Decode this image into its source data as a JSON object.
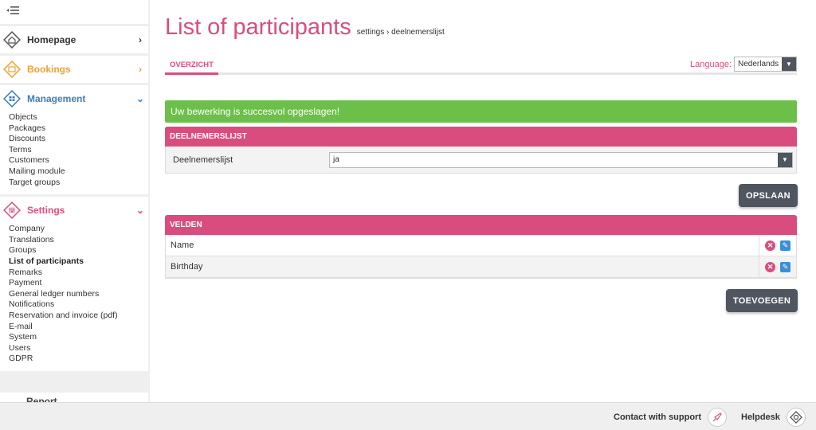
{
  "sidebar": {
    "toggle_icon": "collapse-menu-icon",
    "sections": {
      "homepage": {
        "label": "Homepage",
        "color": "#333333",
        "icon": "home-icon"
      },
      "bookings": {
        "label": "Bookings",
        "color": "#f0a22e",
        "icon": "bookings-icon"
      },
      "management": {
        "label": "Management",
        "color": "#3a7ec2",
        "icon": "management-icon",
        "items": [
          "Objects",
          "Packages",
          "Discounts",
          "Terms",
          "Customers",
          "Mailing module",
          "Target groups"
        ]
      },
      "settings": {
        "label": "Settings",
        "color": "#d94d7e",
        "icon": "settings-icon",
        "items": [
          "Company",
          "Translations",
          "Groups",
          "List of participants",
          "Remarks",
          "Payment",
          "General ledger numbers",
          "Notifications",
          "Reservation and invoice (pdf)",
          "E-mail",
          "System",
          "Users",
          "GDPR"
        ],
        "active_item": "List of participants"
      },
      "report": {
        "label": "Report"
      }
    }
  },
  "main": {
    "title": "List of participants",
    "breadcrumb": "settings › deelnemerslijst",
    "tabs": [
      {
        "label": "OVERZICHT"
      }
    ],
    "language": {
      "label": "Language:",
      "value": "Nederlands"
    },
    "success_message": "Uw bewerking is succesvol opgeslagen!",
    "deelnemerslijst_panel": {
      "title": "DEELNEMERSLIJST",
      "field_label": "Deelnemerslijst",
      "field_value": "ja"
    },
    "save_button": "OPSLAAN",
    "velden_panel": {
      "title": "VELDEN",
      "rows": [
        {
          "name": "Name"
        },
        {
          "name": "Birthday"
        }
      ]
    },
    "add_button": "TOEVOEGEN"
  },
  "footer": {
    "support_label": "Contact with support",
    "support_icon": "rocket-icon",
    "helpdesk_label": "Helpdesk",
    "helpdesk_icon": "lifebuoy-icon"
  },
  "colors": {
    "accent": "#d94d7e",
    "success": "#6cc04a",
    "button": "#4f5660",
    "edit": "#3a8fd8"
  }
}
